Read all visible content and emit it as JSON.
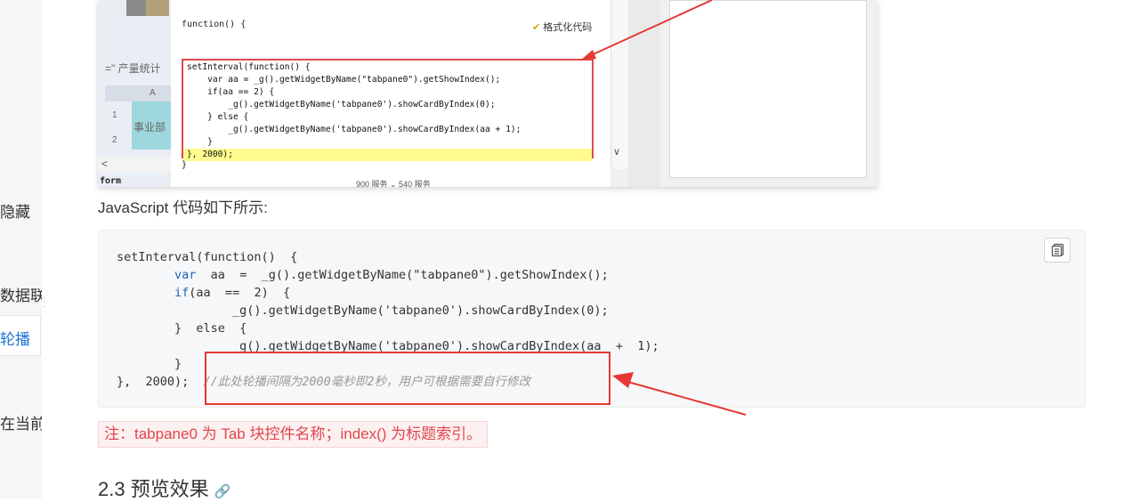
{
  "sidebar": {
    "items": [
      {
        "label": "隐藏"
      },
      {
        "label": "数据联"
      },
      {
        "label": "轮播"
      },
      {
        "label": "在当前窗"
      }
    ]
  },
  "screenshot": {
    "left_label": "=\" 产量统计",
    "col_header": "A",
    "row1": "1",
    "row2": "2",
    "cell_text": "事业部",
    "form_label": "form",
    "function_header": "function() {",
    "format_button": "格式化代码",
    "code_lines": [
      "setInterval(function() {",
      "    var aa = _g().getWidgetByName(\"tabpane0\").getShowIndex();",
      "    if(aa == 2) {",
      "        _g().getWidgetByName('tabpane0').showCardByIndex(0);",
      "    } else {",
      "        _g().getWidgetByName('tabpane0').showCardByIndex(aa + 1);",
      "    }",
      "}, 2000);"
    ],
    "closing_brace": "}",
    "bottom_text": "900   服务 ⌄    540   服务"
  },
  "article": {
    "intro": "JavaScript 代码如下所示:",
    "code": {
      "l1": "setInterval(function()  {",
      "l2_kw": "var",
      "l2_rest": "  aa  =  _g().getWidgetByName(\"tabpane0\").getShowIndex();",
      "l3_kw": "if",
      "l3_rest": "(aa  ==  2)  {",
      "l4": "_g().getWidgetByName('tabpane0').showCardByIndex(0);",
      "l5": "}  else  {",
      "l6": "_g().getWidgetByName('tabpane0').showCardByIndex(aa  +  1);",
      "l7": "}",
      "l8": "},  2000);",
      "comment": "//此处轮播间隔为2000毫秒即2秒，用户可根据需要自行修改"
    },
    "copy_icon": "copy-icon",
    "note": "注：tabpane0 为 Tab 块控件名称；index() 为标题索引。",
    "section_title": "2.3 预览效果",
    "anchor_icon": "link-icon"
  },
  "colors": {
    "accent_blue": "#1f75d6",
    "highlight_red": "#e53935",
    "note_red": "#e0464f"
  }
}
